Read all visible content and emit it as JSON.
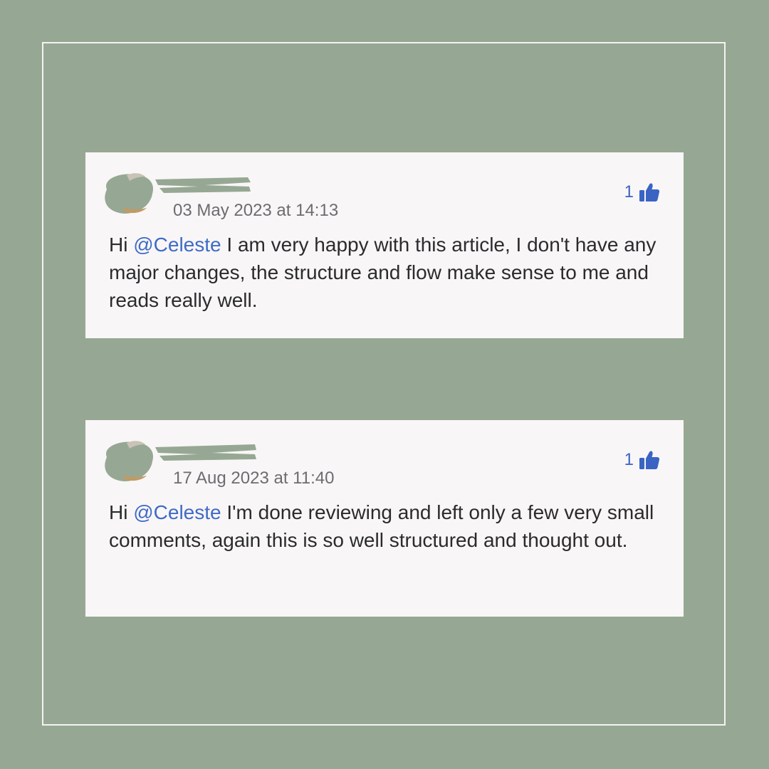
{
  "comments": [
    {
      "timestamp": "03 May 2023 at 14:13",
      "likes": "1",
      "greeting": "Hi",
      "mention": "@Celeste",
      "text": " I am very happy with this article, I don't have any major changes, the structure and flow make sense to me and reads really well."
    },
    {
      "timestamp": "17 Aug 2023 at 11:40",
      "likes": "1",
      "greeting": "Hi",
      "mention": "@Celeste",
      "text": " I'm done reviewing and left only a few very small comments, again this is so well structured and thought out."
    }
  ],
  "icons": {
    "like": "thumbs-up-icon"
  },
  "colors": {
    "background": "#96a893",
    "card": "#f9f6f7",
    "accent": "#3e6bc6",
    "redaction": "#96a893"
  }
}
